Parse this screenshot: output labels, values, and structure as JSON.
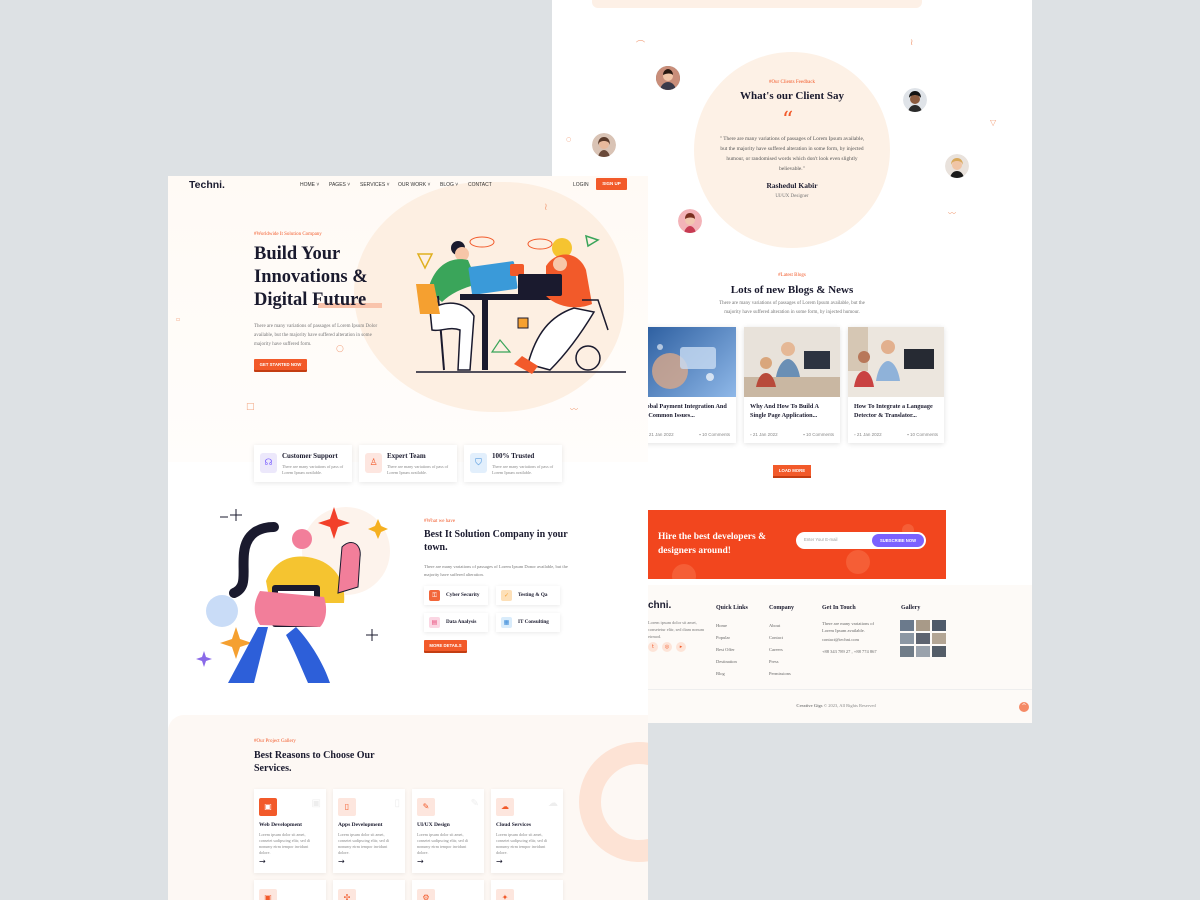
{
  "brand": {
    "logo": "Techni.",
    "footer_logo": "chni.",
    "accent": "#f25a2a",
    "purple": "#7b61ff"
  },
  "nav": {
    "items": [
      "HOME ˅",
      "PAGES ˅",
      "SERVICES ˅",
      "OUR WORK ˅",
      "BLOG ˅",
      "CONTACT"
    ],
    "login": "LOGIN",
    "signup": "SIGN UP"
  },
  "hero": {
    "eyebrow": "#Worldwide It Solution Company",
    "title": "Build Your Innovations & Digital Future",
    "desc": "There are many variations of passages of Lorem Ipsum Dolor available, but the majority have suffered alteration in some majority have suffered form.",
    "cta": "GET STARTED NOW"
  },
  "features": [
    {
      "title": "Customer Support",
      "desc": "There are many variations of pass of Lorem Ipsum available.",
      "icon": "headset-icon"
    },
    {
      "title": "Expert Team",
      "desc": "There are many variations of pass of Lorem Ipsum available.",
      "icon": "team-icon"
    },
    {
      "title": "100% Trusted",
      "desc": "There are many variations of pass of Lorem Ipsum available.",
      "icon": "shield-icon"
    }
  ],
  "about": {
    "eyebrow": "#What we have",
    "title": "Best It Solution Company in your town.",
    "desc": "There are many variations of passages of Lorem Ipsum Donor available, but the majority have suffered alteration.",
    "services": [
      "Cyber Security",
      "Testing & Qa",
      "Data Analysis",
      "IT Consulting"
    ],
    "cta": "MORE DETAILS"
  },
  "gallery": {
    "eyebrow": "#Our Project Gallery",
    "title": "Best Reasons to Choose Our Services.",
    "cards": [
      {
        "title": "Web Development",
        "desc": "Lorem ipsum dolor sit amet, consetet sadipscing elitr, sed di nonumy eirm tempor invidunt dolore.",
        "arrow": "→"
      },
      {
        "title": "Apps Development",
        "desc": "Lorem ipsum dolor sit amet, consetet sadipscing elitr, sed di nonumy eirm tempor invidunt dolore.",
        "arrow": "→"
      },
      {
        "title": "UI/UX Design",
        "desc": "Lorem ipsum dolor sit amet, consetet sadipscing elitr, sed di nonumy eirm tempor invidunt dolore.",
        "arrow": "→"
      },
      {
        "title": "Cloud Services",
        "desc": "Lorem ipsum dolor sit amet, consetet sadipscing elitr, sed di nonumy eirm tempor invidunt dolore.",
        "arrow": "→"
      }
    ]
  },
  "testimonial": {
    "eyebrow": "#Our Clients Feedback",
    "title": "What's our Client Say",
    "quote_mark": "“",
    "quote": "\" There are many variations of passages of Lorem Ipsum available, but the majority have suffered alteration in some form, by injected humour, or randomised words which don't look even slightly believable.\"",
    "name": "Rashedul Kabir",
    "role": "UI/UX Designer"
  },
  "blog": {
    "eyebrow": "#Latest Blogs",
    "title": "Lots of new Blogs & News",
    "desc": "There are many variations of passages of Lorem Ipsum available, but the majority have suffered alteration in some form, by injected humour.",
    "posts": [
      {
        "title": "Global Payment Integration And Its Common Issues...",
        "date": "21 Jan 2022",
        "comments": "10 Comments"
      },
      {
        "title": "Why And How To Build A Single Page Application...",
        "date": "21 Jan 2022",
        "comments": "10 Comments"
      },
      {
        "title": "How To Integrate a Language Detector & Translator...",
        "date": "21 Jan 2022",
        "comments": "10 Comments"
      }
    ],
    "load_more": "LOAD MORE"
  },
  "hire": {
    "title": "Hire the best developers & designers around!",
    "placeholder": "Enter Your E-mail",
    "button": "SUBSCRIBE NOW"
  },
  "footer": {
    "about": "Lorem ipsum dolor sit amet, consetetur elitr, sed diam nonum eirmod.",
    "social_icons": [
      "twitter-icon",
      "instagram-icon",
      "youtube-icon"
    ],
    "columns": {
      "quick_links": {
        "title": "Quick Links",
        "links": [
          "Home",
          "Popular",
          "Best Offer",
          "Destination",
          "Blog"
        ]
      },
      "company": {
        "title": "Company",
        "links": [
          "About",
          "Contact",
          "Careers",
          "Press",
          "Permissions"
        ]
      },
      "get_in_touch": {
        "title": "Get In Touch",
        "text": "There are many variations of Lorem Ipsum available.",
        "email": "contact@techni.com",
        "phone": "+88 343 789 27 , +88 774 867"
      },
      "gallery": {
        "title": "Gallery"
      }
    },
    "copyright_brand": "Creative Gigs",
    "copyright": " © 2023, All Rights Reserved",
    "scroll_top": "^"
  }
}
